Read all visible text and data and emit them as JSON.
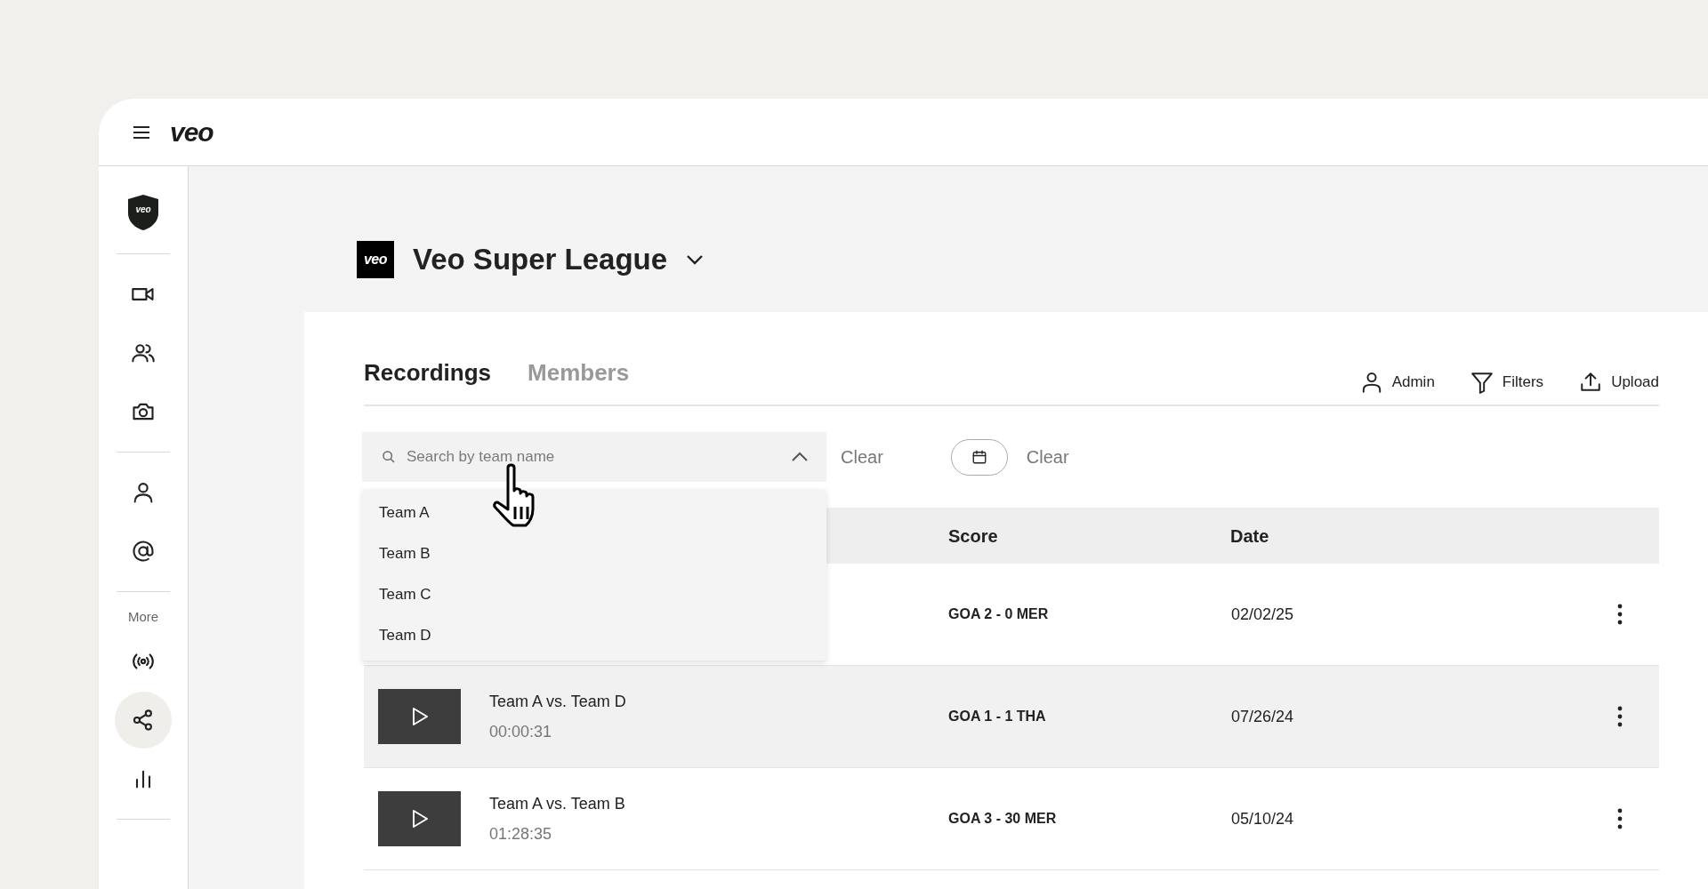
{
  "topbar": {
    "logo": "veo"
  },
  "sidebar": {
    "logo": "veo",
    "items": [
      {
        "kind": "divider"
      },
      {
        "kind": "video",
        "selected": false
      },
      {
        "kind": "people",
        "selected": false
      },
      {
        "kind": "camera",
        "selected": false
      },
      {
        "kind": "divider"
      },
      {
        "kind": "person",
        "selected": false
      },
      {
        "kind": "at",
        "selected": false
      },
      {
        "kind": "divider"
      },
      {
        "kind": "label",
        "text": "More"
      },
      {
        "kind": "broadcast",
        "selected": false
      },
      {
        "kind": "share",
        "selected": true
      },
      {
        "kind": "chart",
        "selected": false
      },
      {
        "kind": "divider"
      }
    ]
  },
  "header": {
    "logo": "veo",
    "title": "Veo Super League"
  },
  "tabs": [
    {
      "label": "Recordings",
      "selected": true
    },
    {
      "label": "Members",
      "selected": false
    }
  ],
  "actions": [
    {
      "kind": "admin",
      "label": "Admin"
    },
    {
      "kind": "filters",
      "label": "Filters"
    },
    {
      "kind": "upload",
      "label": "Upload"
    }
  ],
  "search": {
    "placeholder": "Search by team name",
    "expanded": true,
    "clear": "Clear",
    "options": [
      "Team A",
      "Team B",
      "Team C",
      "Team D"
    ]
  },
  "date_filter": {
    "clear": "Clear"
  },
  "table": {
    "columns": [
      "Score",
      "Date"
    ],
    "rows": [
      {
        "score": "GOA 2 - 0 MER",
        "date": "02/02/25",
        "hovered": false
      },
      {
        "title": "Team A vs. Team D",
        "duration": "00:00:31",
        "score": "GOA 1 - 1 THA",
        "date": "07/26/24",
        "hovered": true
      },
      {
        "title": "Team A vs. Team B",
        "duration": "01:28:35",
        "score": "GOA 3 - 30 MER",
        "date": "05/10/24",
        "hovered": false
      }
    ]
  }
}
